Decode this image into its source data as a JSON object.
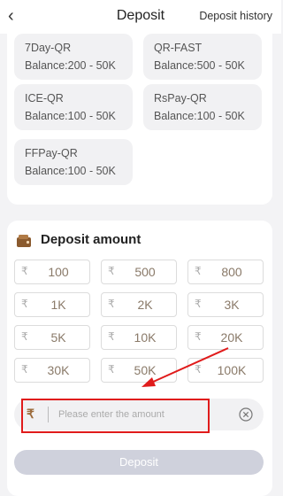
{
  "header": {
    "back_icon": "chevron-left-icon",
    "title": "Deposit",
    "history_link": "Deposit history"
  },
  "channels": [
    {
      "name": "7Day-QR",
      "balance": "Balance:200 - 50K"
    },
    {
      "name": "QR-FAST",
      "balance": "Balance:500 - 50K"
    },
    {
      "name": "ICE-QR",
      "balance": "Balance:100 - 50K"
    },
    {
      "name": "RsPay-QR",
      "balance": "Balance:100 - 50K"
    },
    {
      "name": "FFPay-QR",
      "balance": "Balance:100 - 50K"
    }
  ],
  "deposit_amount": {
    "section_icon": "wallet-icon",
    "title": "Deposit amount",
    "currency_symbol": "₹",
    "amounts": [
      "100",
      "500",
      "800",
      "1K",
      "2K",
      "3K",
      "5K",
      "10K",
      "20K",
      "30K",
      "50K",
      "100K"
    ],
    "input_placeholder": "Please enter the amount",
    "clear_icon": "clear-icon",
    "deposit_button": "Deposit"
  },
  "colors": {
    "accent": "#9b6a3a",
    "annotation": "#e01b1b",
    "button_disabled": "#cfd1dc"
  }
}
